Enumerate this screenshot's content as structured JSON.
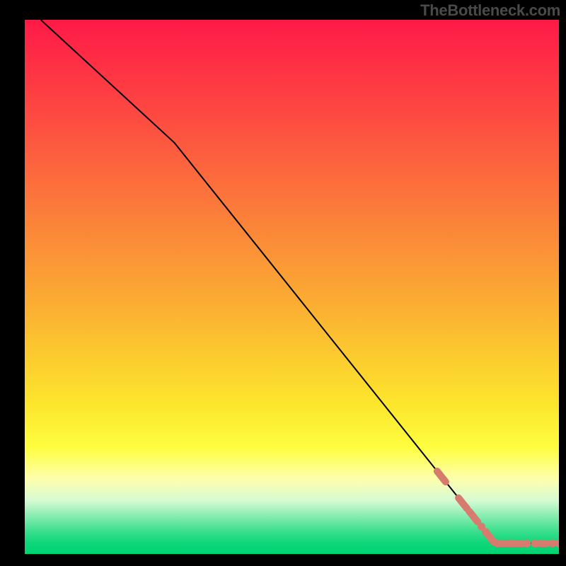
{
  "watermark": "TheBottleneck.com",
  "colors": {
    "line": "#000000",
    "marker": "#d87b6f",
    "frame": "#000000"
  },
  "chart_data": {
    "type": "line",
    "title": "",
    "xlabel": "",
    "ylabel": "",
    "xlim": [
      0,
      100
    ],
    "ylim": [
      0,
      100
    ],
    "grid": false,
    "legend": false,
    "background": {
      "type": "vertical-gradient",
      "stops": [
        {
          "offset": 0.0,
          "color": "#fe1a47"
        },
        {
          "offset": 0.18,
          "color": "#fd4a41"
        },
        {
          "offset": 0.36,
          "color": "#fb7d3a"
        },
        {
          "offset": 0.54,
          "color": "#fbb032"
        },
        {
          "offset": 0.72,
          "color": "#fce62c"
        },
        {
          "offset": 0.8,
          "color": "#fefd3f"
        },
        {
          "offset": 0.86,
          "color": "#feffae"
        },
        {
          "offset": 0.9,
          "color": "#d6fad3"
        },
        {
          "offset": 0.93,
          "color": "#84ecae"
        },
        {
          "offset": 0.96,
          "color": "#34de8a"
        },
        {
          "offset": 0.98,
          "color": "#0dd678"
        },
        {
          "offset": 1.0,
          "color": "#00d373"
        }
      ]
    },
    "series": [
      {
        "name": "curve",
        "stroke": "#000000",
        "points": [
          {
            "x": 3,
            "y": 100
          },
          {
            "x": 28,
            "y": 77
          },
          {
            "x": 88,
            "y": 2
          },
          {
            "x": 100,
            "y": 2
          }
        ]
      }
    ],
    "markers": {
      "color": "#d87b6f",
      "note": "Approximate x positions of salmon data dots/dashes along the tail of the curve. y is derived from the line at each x.",
      "points": [
        {
          "x": 78,
          "kind": "dash_segment_start"
        },
        {
          "x": 82,
          "kind": "dash_segment_mid"
        },
        {
          "x": 84,
          "kind": "dash_segment_mid"
        },
        {
          "x": 85.5,
          "kind": "dot"
        },
        {
          "x": 86.3,
          "kind": "dot"
        },
        {
          "x": 87.0,
          "kind": "dash_segment_end"
        },
        {
          "x": 88.5,
          "kind": "dot"
        },
        {
          "x": 90.0,
          "kind": "dash"
        },
        {
          "x": 91.2,
          "kind": "dot"
        },
        {
          "x": 92.5,
          "kind": "dash"
        },
        {
          "x": 94.0,
          "kind": "dot"
        },
        {
          "x": 95.5,
          "kind": "dot"
        },
        {
          "x": 97.0,
          "kind": "dash"
        },
        {
          "x": 98.8,
          "kind": "dot"
        },
        {
          "x": 100.0,
          "kind": "dot"
        }
      ]
    }
  }
}
